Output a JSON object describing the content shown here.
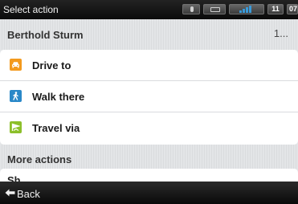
{
  "status_bar": {
    "title": "Select action",
    "time_hour": "11",
    "time_minute": "07",
    "signal_color": "#3a9ad9"
  },
  "contact": {
    "name": "Berthold Sturm",
    "extra": "1..."
  },
  "actions": [
    {
      "label": "Drive to",
      "icon": "car-icon",
      "color": "#f39a1e"
    },
    {
      "label": "Walk there",
      "icon": "walker-icon",
      "color": "#2a88c8"
    },
    {
      "label": "Travel via",
      "icon": "flag-icon",
      "color": "#8cbf2a"
    }
  ],
  "more_section": {
    "title": "More actions",
    "partial_item": "Sh..."
  },
  "bottom_bar": {
    "back_label": "Back"
  }
}
